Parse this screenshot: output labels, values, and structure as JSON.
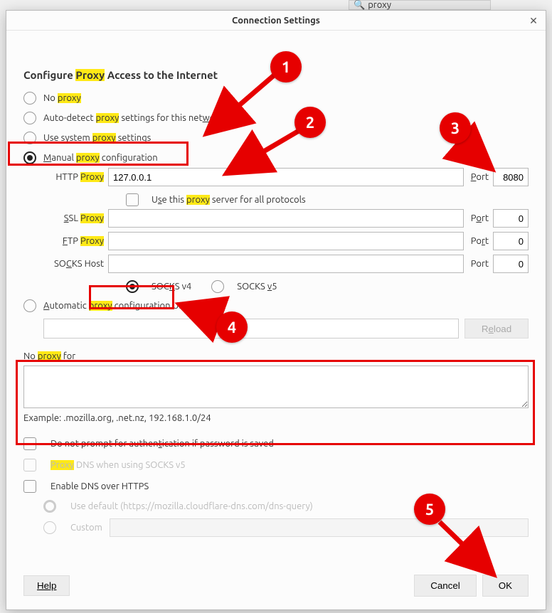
{
  "background": {
    "search_placeholder": "proxy"
  },
  "dialog": {
    "title": "Connection Settings",
    "heading_pre": "Configure ",
    "heading_hl": "Proxy",
    "heading_post": " Access to the Internet",
    "close_glyph": "✕"
  },
  "radios": {
    "no_proxy": {
      "pre": "No ",
      "hl": "proxy"
    },
    "auto_detect": {
      "pre": "Auto-detect ",
      "hl": "proxy",
      "post1": " settings for this net",
      "u": "w",
      "post2": "ork"
    },
    "use_system": {
      "pre1": "Use s",
      "u1": "y",
      "pre2": "stem ",
      "hl": "proxy",
      "post": " settings"
    },
    "manual": {
      "u": "M",
      "pre": "anual ",
      "hl": "proxy",
      "post": " configuration"
    },
    "auto_url": {
      "u": "A",
      "pre": "utomatic ",
      "hl": "proxy",
      "post": " configuration URL"
    }
  },
  "http": {
    "label_pre": "HTTP ",
    "label_hl": "Proxy",
    "value": "127.0.0.1",
    "port_u": "P",
    "port_rest": "ort",
    "port": "8080"
  },
  "use_all": {
    "pre1": "U",
    "u": "s",
    "pre2": "e this ",
    "hl": "proxy",
    "post": " server for all protocols"
  },
  "ssl": {
    "u": "S",
    "rest": "SL ",
    "hl": "Proxy",
    "port_pre": "P",
    "port_u": "o",
    "port_post": "rt",
    "port": "0"
  },
  "ftp": {
    "u": "F",
    "rest": "TP ",
    "hl": "Proxy",
    "port_pre": "Po",
    "port_u": "r",
    "port_post": "t",
    "port": "0"
  },
  "socks_host": {
    "pre": "SO",
    "u": "C",
    "post": "KS Host",
    "port": "Port",
    "port_val": "0"
  },
  "socks_v4": {
    "pre": "SOC",
    "u": "K",
    "post": "S v4"
  },
  "socks_v5": {
    "pre": "SOCKS ",
    "u": "v",
    "post": "5"
  },
  "reload": {
    "u": "e",
    "pre": "R",
    "post": "load"
  },
  "no_proxy_for": {
    "u": "N",
    "pre": "o ",
    "hl": "proxy",
    "post": " for"
  },
  "example": "Example: .mozilla.org, .net.nz, 192.168.1.0/24",
  "no_prompt": {
    "pre": "Do not prompt for authen",
    "u": "t",
    "post": "ication if password is saved"
  },
  "proxy_dns": {
    "hl": "Proxy",
    "post": " DNS when using SOCKS v5"
  },
  "enable_doh": "Enable DNS over HTTPS",
  "doh_default": "Use default (https://mozilla.cloudflare-dns.com/dns-query)",
  "doh_custom": "Custom",
  "footer": {
    "help": "Help",
    "cancel": "Cancel",
    "ok": "OK"
  },
  "annotations": {
    "1": "1",
    "2": "2",
    "3": "3",
    "4": "4",
    "5": "5"
  }
}
